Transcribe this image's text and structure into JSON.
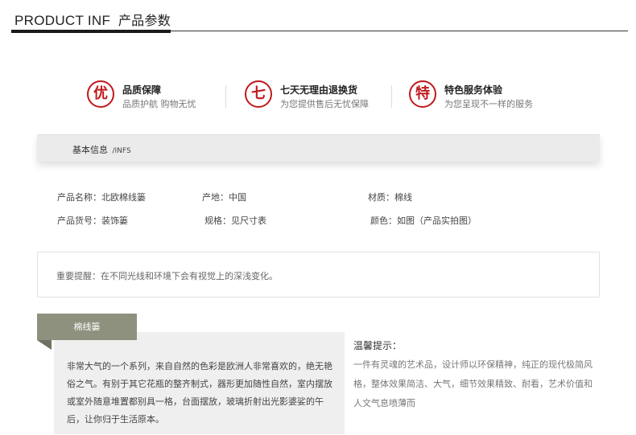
{
  "header": {
    "title_en": "PRODUCT INF",
    "title_cn": "产品参数"
  },
  "features": [
    {
      "icon_char": "优",
      "icon": "quality-badge-icon",
      "title": "品质保障",
      "subtitle": "品质护航 购物无忧"
    },
    {
      "icon_char": "七",
      "icon": "seven-day-return-icon",
      "title": "七天无理由退换货",
      "subtitle": "为您提供售后无忧保障"
    },
    {
      "icon_char": "特",
      "icon": "special-service-icon",
      "title": "特色服务体验",
      "subtitle": "为您呈现不一样的服务"
    }
  ],
  "info_bar": {
    "label_cn": "基本信息",
    "label_en": "/INFS"
  },
  "specs": {
    "row1": {
      "name": "产品名称：北欧棉线篓",
      "origin": "产地：中国",
      "material": "材质：棉线"
    },
    "row2": {
      "code": "产品货号：装饰篓",
      "size": "规格：见尺寸表",
      "color": "颜色：如图（产品实拍图）"
    }
  },
  "notice": "重要提醒：在不同光线和环境下会有视觉上的深浅变化。",
  "product_tab": {
    "label": "棉线篓",
    "description": "非常大气的一个系列，来自自然的色彩是欧洲人非常喜欢的，绝无艳俗之气。有别于其它花瓶的整齐制式，器形更加随性自然，室内摆放或室外随意堆置都别具一格，台面摆放，玻璃折射出光影婆娑的午后，让你归于生活原本。"
  },
  "tips": {
    "title": "温馨提示：",
    "text": "一件有灵魂的艺术品，设计师以环保精神，纯正的现代极简风格，整体效果简洁、大气，细节效果精致、耐看，艺术价值和人文气息喷薄而"
  },
  "colors": {
    "accent_red": "#c0191d",
    "tab_green": "#8d917d"
  }
}
